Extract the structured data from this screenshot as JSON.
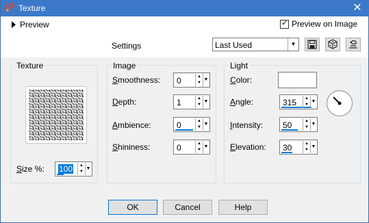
{
  "window": {
    "title": "Texture",
    "close_symbol": "✕"
  },
  "toolbar": {
    "preview_label": "Preview",
    "preview_on_image_label": "Preview on Image",
    "preview_on_image_checked": true
  },
  "settings": {
    "label": "Settings",
    "preset_value": "Last Used"
  },
  "texture": {
    "group_title": "Texture",
    "size_label_prefix": "S",
    "size_label_rest": "ize %:",
    "size_value": "100"
  },
  "image": {
    "group_title": "Image",
    "smoothness_label_u": "S",
    "smoothness_label_rest": "moothness:",
    "smoothness_value": "0",
    "depth_label_u": "D",
    "depth_label_rest": "epth:",
    "depth_value": "1",
    "ambience_label_u": "A",
    "ambience_label_rest": "mbience:",
    "ambience_value": "0",
    "shininess_label_u": "S",
    "shininess_label_rest": "hininess:",
    "shininess_value": "0"
  },
  "light": {
    "group_title": "Light",
    "color_label_u": "C",
    "color_label_rest": "olor:",
    "color_value": "#ffffff",
    "angle_label_u": "A",
    "angle_label_rest": "ngle:",
    "angle_value": "315",
    "intensity_label_u": "I",
    "intensity_label_rest": "ntensity:",
    "intensity_value": "50",
    "elevation_label_u": "E",
    "elevation_label_rest": "levation:",
    "elevation_value": "30"
  },
  "buttons": {
    "ok": "OK",
    "cancel": "Cancel",
    "help": "Help"
  },
  "colors": {
    "titlebar": "#3c79c9",
    "accent": "#0078d7"
  }
}
